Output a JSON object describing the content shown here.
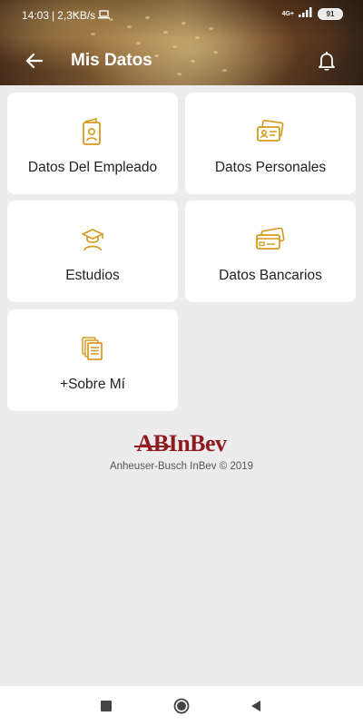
{
  "status_bar": {
    "time": "14:03",
    "network_speed": "2,3KB/s",
    "laptop_icon": "laptop-icon",
    "network_type": "4G+",
    "signal_icon": "signal-icon",
    "battery_level": "91"
  },
  "header": {
    "title": "Mis Datos",
    "back_icon": "arrow-left-icon",
    "notification_icon": "bell-icon"
  },
  "cards": [
    {
      "label": "Datos Del Empleado",
      "icon": "employee-badge-icon"
    },
    {
      "label": "Datos Personales",
      "icon": "id-cards-icon"
    },
    {
      "label": "Estudios",
      "icon": "graduate-icon"
    },
    {
      "label": "Datos Bancarios",
      "icon": "bank-cards-icon"
    },
    {
      "label": "+Sobre Mí",
      "icon": "documents-icon"
    }
  ],
  "footer": {
    "logo_text": "ABInBev",
    "copyright": "Anheuser-Busch InBev © 2019"
  },
  "nav": {
    "recent_icon": "square-icon",
    "home_icon": "circle-icon",
    "back_icon": "triangle-back-icon"
  },
  "colors": {
    "accent": "#d59a1c",
    "background": "#ececec",
    "card": "#ffffff",
    "logo": "#8f1a1f"
  }
}
